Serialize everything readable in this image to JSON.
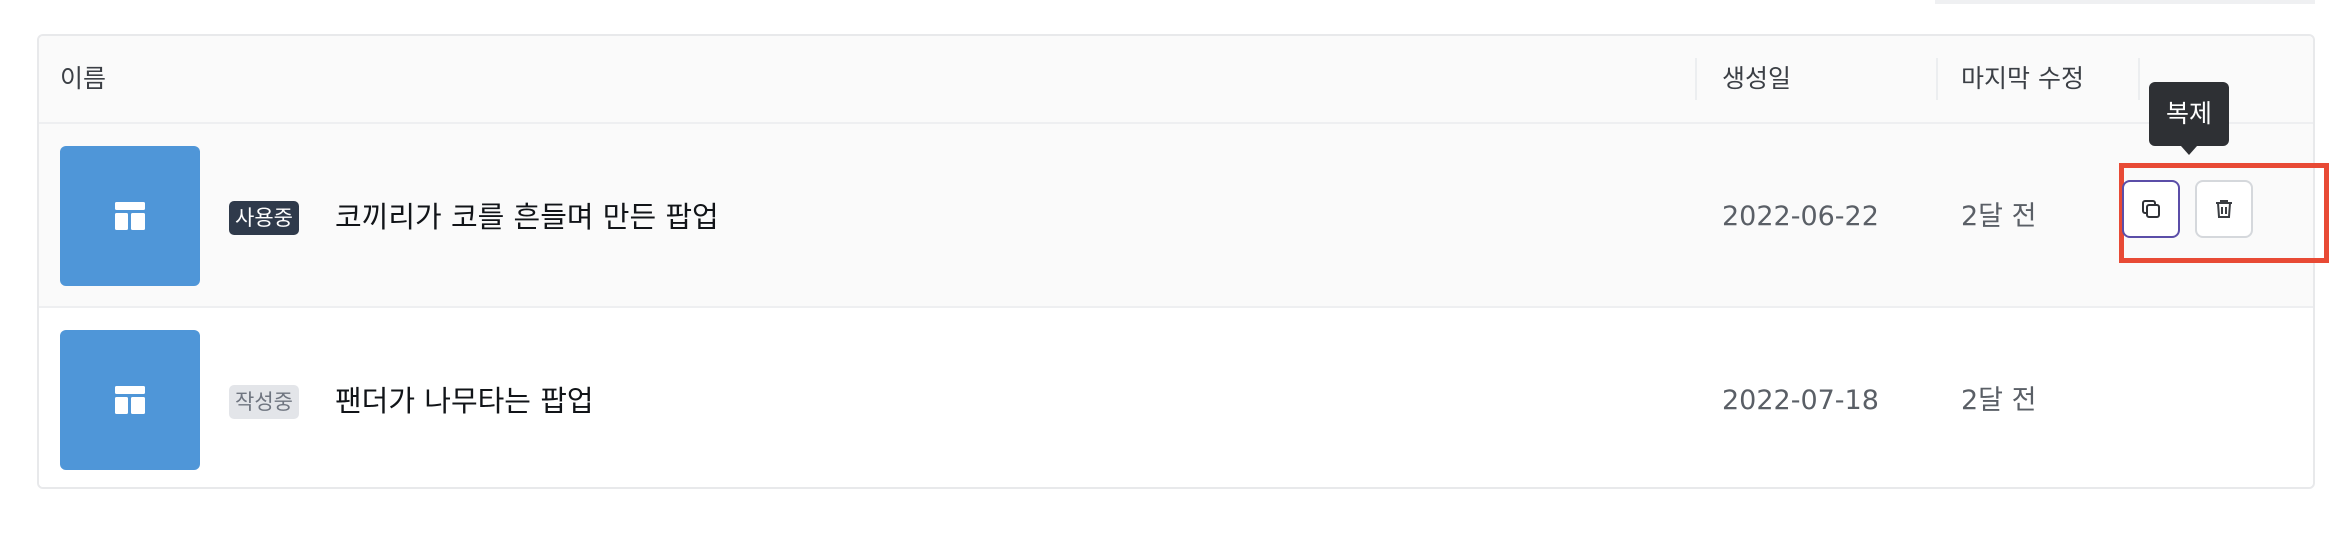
{
  "table": {
    "columns": {
      "name": "이름",
      "created": "생성일",
      "modified": "마지막 수정"
    },
    "rows": [
      {
        "status": "사용중",
        "title": "코끼리가 코를 흔들며 만든 팝업",
        "created": "2022-06-22",
        "modified": "2달 전",
        "thumb_icon": "layout-icon"
      },
      {
        "status": "작성중",
        "title": "팬더가 나무타는 팝업",
        "created": "2022-07-18",
        "modified": "2달 전",
        "thumb_icon": "layout-icon"
      }
    ]
  },
  "tooltip": {
    "text": "복제"
  },
  "actions": {
    "copy_icon": "copy-icon",
    "delete_icon": "trash-icon"
  },
  "colors": {
    "thumb": "#4f96d8",
    "active_badge": "#2f3a4b",
    "draft_badge": "#e3e5e9",
    "highlight": "#e84a35",
    "copy_border": "#5b4ea8"
  }
}
